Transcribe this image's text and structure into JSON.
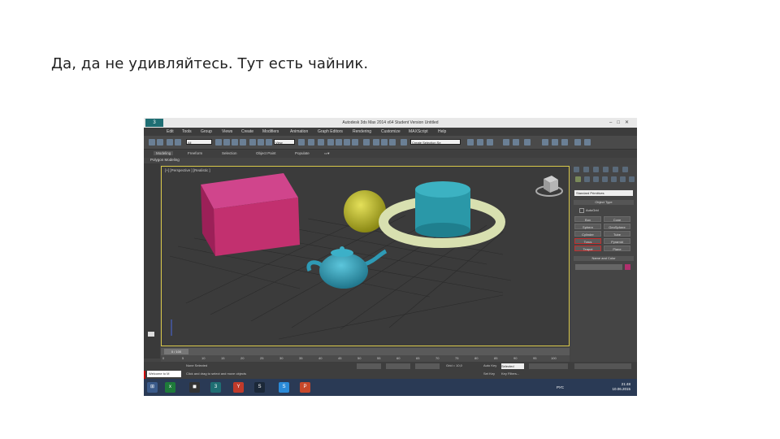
{
  "caption": "Да, да не удивляйтесь. Тут есть чайник.",
  "app": {
    "title": "Autodesk 3ds Max 2014 x64    Student Version    Untitled",
    "window_controls": [
      "–",
      "□",
      "✕"
    ]
  },
  "menu": [
    "Edit",
    "Tools",
    "Group",
    "Views",
    "Create",
    "Modifiers",
    "Animation",
    "Graph Editors",
    "Rendering",
    "Customize",
    "MAXScript",
    "Help"
  ],
  "toolbar": {
    "selection_filter": "All",
    "coord_system": "View",
    "named_selection": "Create Selection Se"
  },
  "ribbon": {
    "tabs": [
      "Modeling",
      "Freeform",
      "Selection",
      "Object Paint",
      "Populate"
    ],
    "active_tab": "Modeling",
    "panel_label": "Polygon Modeling"
  },
  "viewport": {
    "label": "[+] [Perspective ] [Realistic ]"
  },
  "command_panel": {
    "category": "Standard Primitives",
    "object_type_title": "Object Type",
    "autogrid": "AutoGrid",
    "buttons": [
      "Box",
      "Cone",
      "Sphere",
      "GeoSphere",
      "Cylinder",
      "Tube",
      "Torus",
      "Pyramid",
      "Teapot",
      "Plane"
    ],
    "highlighted": "Teapot",
    "name_color_title": "Name and Color",
    "object_color": "#b0306e"
  },
  "timeline": {
    "frame": "0 / 100",
    "ticks": [
      "0",
      "5",
      "10",
      "15",
      "20",
      "25",
      "30",
      "35",
      "40",
      "45",
      "50",
      "55",
      "60",
      "65",
      "70",
      "75",
      "80",
      "85",
      "90",
      "95",
      "100"
    ]
  },
  "status": {
    "welcome": "Welcome to M",
    "line1": "None Selected",
    "line2": "Click and drag to select and move objects",
    "auto_key": "Auto Key",
    "selected": "Selected",
    "set_key": "Set Key",
    "key_filters": "Key Filters...",
    "grid": "Grid = 10,0"
  },
  "taskbar": {
    "tray_lang": "РУС",
    "time": "21:48",
    "date": "10.06.2015"
  },
  "colors": {
    "box": "#c2306f",
    "sphere": "#b2b028",
    "cylinder": "#2a98a8",
    "torus": "#d8e0b0",
    "teapot": "#2e9ab5"
  }
}
